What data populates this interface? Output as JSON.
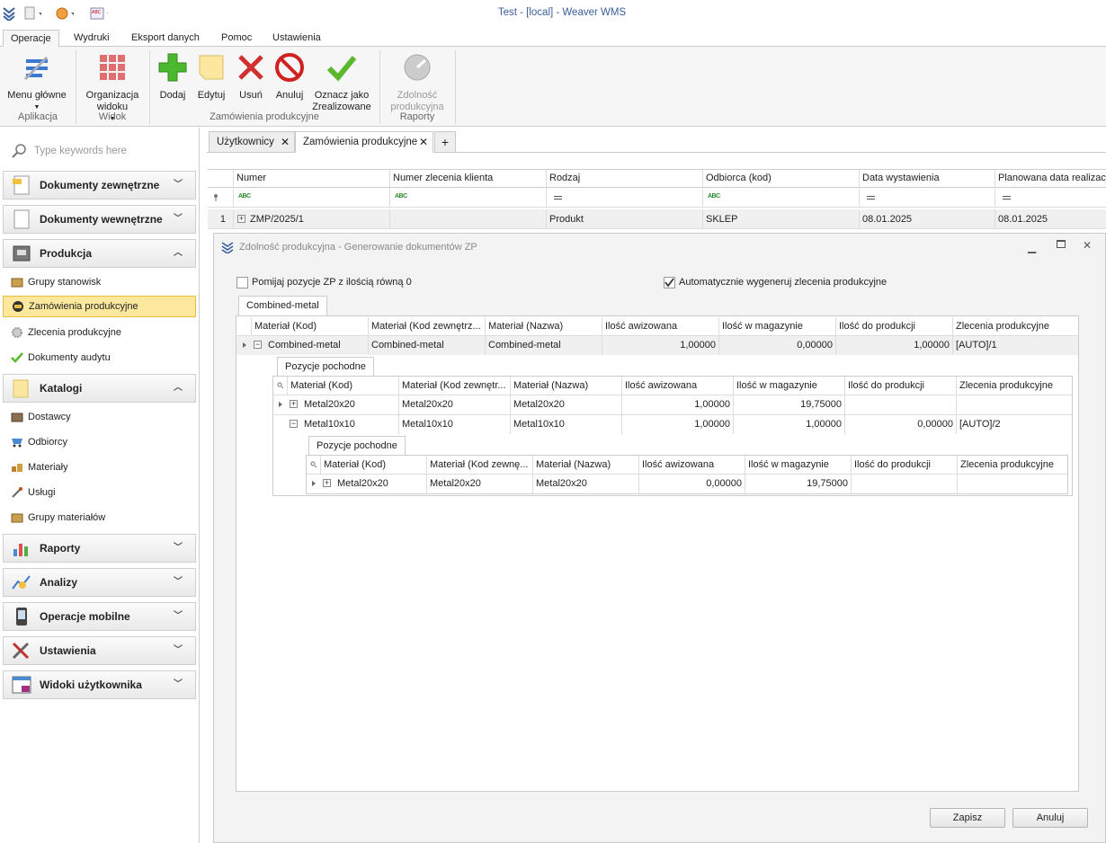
{
  "window": {
    "title": "Test - [local] - Weaver WMS"
  },
  "menu_tabs": [
    "Operacje",
    "Wydruki",
    "Eksport danych",
    "Pomoc",
    "Ustawienia"
  ],
  "ribbon": {
    "buttons": {
      "menu": "Menu główne",
      "org1": "Organizacja",
      "org2": "widoku",
      "add": "Dodaj",
      "edit": "Edytuj",
      "delete": "Usuń",
      "cancel": "Anuluj",
      "mark1": "Oznacz jako",
      "mark2": "Zrealizowane",
      "cap1": "Zdolność",
      "cap2": "produkcyjna"
    },
    "groups": {
      "app": "Aplikacja",
      "view": "Widok",
      "orders": "Zamówienia produkcyjne",
      "reports": "Raporty"
    }
  },
  "sidebar": {
    "search_placeholder": "Type keywords here",
    "categories": {
      "ext": "Dokumenty zewnętrzne",
      "int": "Dokumenty wewnętrzne",
      "prod": "Produkcja",
      "cat": "Katalogi",
      "rep": "Raporty",
      "ana": "Analizy",
      "mob": "Operacje mobilne",
      "set": "Ustawienia",
      "usr": "Widoki użytkownika"
    },
    "prod_items": [
      "Grupy stanowisk",
      "Zamówienia produkcyjne",
      "Zlecenia produkcyjne",
      "Dokumenty audytu"
    ],
    "cat_items": [
      "Dostawcy",
      "Odbiorcy",
      "Materiały",
      "Usługi",
      "Grupy materiałów"
    ]
  },
  "doc_tabs": [
    "Użytkownicy",
    "Zamówienia produkcyjne"
  ],
  "main_grid": {
    "columns": [
      "Numer",
      "Numer zlecenia klienta",
      "Rodzaj",
      "Odbiorca (kod)",
      "Data wystawienia",
      "Planowana data realizacji"
    ],
    "row": {
      "index": "1",
      "numer": "ZMP/2025/1",
      "klient": "",
      "rodzaj": "Produkt",
      "odbiorca": "SKLEP",
      "data": "08.01.2025",
      "plan": "08.01.2025"
    }
  },
  "dialog": {
    "title": "Zdolność produkcyjna - Generowanie dokumentów ZP",
    "opt_skip": "Pomijaj pozycje ZP z ilością równą 0",
    "opt_auto": "Automatycznie wygeneruj zlecenia produkcyjne",
    "opt_skip_checked": false,
    "opt_auto_checked": true,
    "tab": "Combined-metal",
    "level1": {
      "columns": [
        "Materiał (Kod)",
        "Materiał (Kod zewnętrz...",
        "Materiał (Nazwa)",
        "Ilość awizowana",
        "Ilość w magazynie",
        "Ilość do produkcji",
        "Zlecenia produkcyjne"
      ],
      "row": [
        "Combined-metal",
        "Combined-metal",
        "Combined-metal",
        "1,00000",
        "0,00000",
        "1,00000",
        "[AUTO]/1"
      ]
    },
    "level2": {
      "tab": "Pozycje pochodne",
      "columns": [
        "Materiał (Kod)",
        "Materiał (Kod zewnętr...",
        "Materiał (Nazwa)",
        "Ilość awizowana",
        "Ilość w magazynie",
        "Ilość do produkcji",
        "Zlecenia produkcyjne"
      ],
      "rows": [
        [
          "Metal20x20",
          "Metal20x20",
          "Metal20x20",
          "1,00000",
          "19,75000",
          "",
          ""
        ],
        [
          "Metal10x10",
          "Metal10x10",
          "Metal10x10",
          "1,00000",
          "1,00000",
          "0,00000",
          "[AUTO]/2"
        ]
      ]
    },
    "level3": {
      "tab": "Pozycje pochodne",
      "columns": [
        "Materiał (Kod)",
        "Materiał (Kod zewnę...",
        "Materiał (Nazwa)",
        "Ilość awizowana",
        "Ilość w magazynie",
        "Ilość do produkcji",
        "Zlecenia produkcyjne"
      ],
      "row": [
        "Metal20x20",
        "Metal20x20",
        "Metal20x20",
        "0,00000",
        "19,75000",
        "",
        ""
      ]
    },
    "save": "Zapisz",
    "cancel": "Anuluj"
  }
}
